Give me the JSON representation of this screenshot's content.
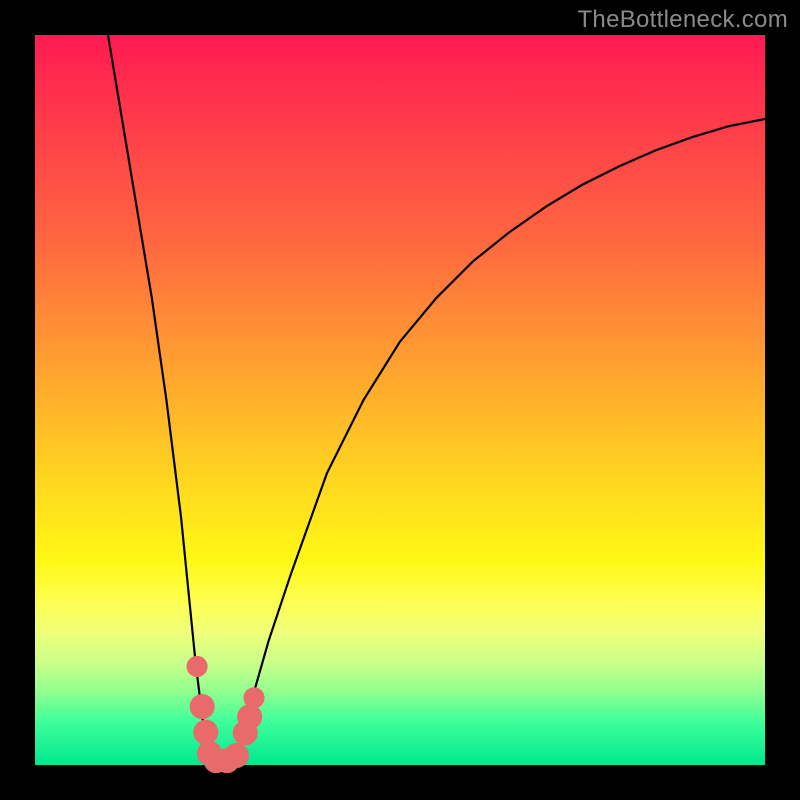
{
  "watermark": "TheBottleneck.com",
  "chart_data": {
    "type": "line",
    "title": "",
    "xlabel": "",
    "ylabel": "",
    "xlim": [
      0,
      100
    ],
    "ylim": [
      0,
      100
    ],
    "series": [
      {
        "name": "curve",
        "x": [
          10,
          12,
          14,
          16,
          18,
          19,
          20,
          21,
          22,
          23,
          24,
          25,
          26,
          27,
          28,
          29,
          30,
          32,
          35,
          40,
          45,
          50,
          55,
          60,
          65,
          70,
          75,
          80,
          85,
          90,
          95,
          100
        ],
        "values": [
          100,
          88,
          76,
          64,
          50,
          42,
          34,
          24,
          14,
          6,
          1,
          0,
          0,
          1,
          3,
          6,
          10,
          17,
          26,
          40,
          50,
          58,
          64,
          69,
          73,
          76.5,
          79.5,
          82,
          84.2,
          86,
          87.5,
          88.5
        ]
      }
    ],
    "markers": [
      {
        "x": 22.2,
        "y": 13.5,
        "r": 1.0
      },
      {
        "x": 22.9,
        "y": 8.0,
        "r": 1.3
      },
      {
        "x": 23.4,
        "y": 4.5,
        "r": 1.3
      },
      {
        "x": 23.9,
        "y": 1.6,
        "r": 1.3
      },
      {
        "x": 24.8,
        "y": 0.6,
        "r": 1.3
      },
      {
        "x": 26.3,
        "y": 0.6,
        "r": 1.3
      },
      {
        "x": 27.6,
        "y": 1.3,
        "r": 1.3
      },
      {
        "x": 28.8,
        "y": 4.4,
        "r": 1.3
      },
      {
        "x": 29.4,
        "y": 6.6,
        "r": 1.3
      },
      {
        "x": 30.0,
        "y": 9.2,
        "r": 1.0
      }
    ],
    "colors": {
      "curve": "#000000",
      "marker": "#e86a6a"
    }
  }
}
